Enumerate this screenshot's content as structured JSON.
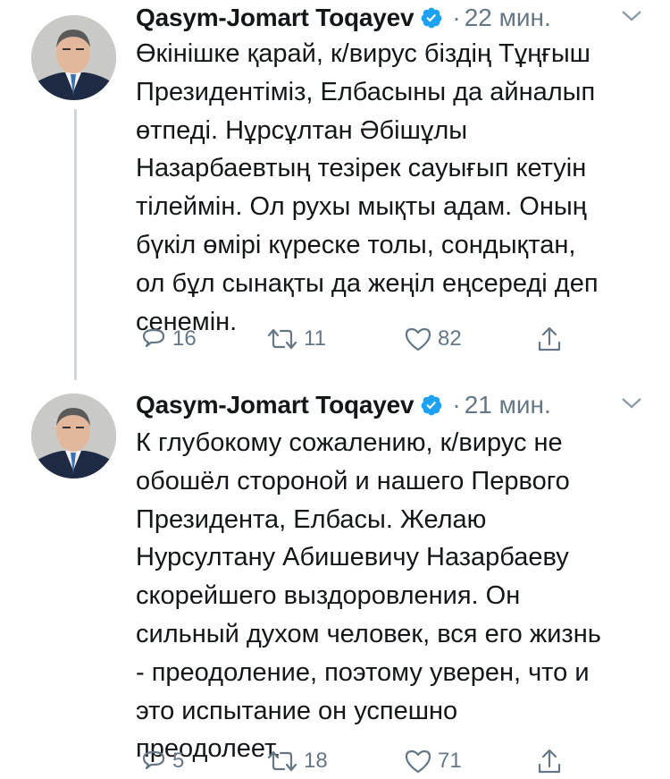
{
  "tweets": [
    {
      "author": "Qasym-Jomart Toqayev",
      "separator": "·",
      "time": "22 мин.",
      "text": "Өкінішке қарай, к/вирус біздің Тұңғыш\nПрезидентіміз, Елбасыны да айналып\nөтпеді. Нұрсұлтан Әбішұлы\nНазарбаевтың тезірек сауығып кетуін\nтілеймін. Ол рухы мықты адам. Оның\nбүкіл өмірі күреске толы, сондықтан,\nол бұл сынақты да жеңіл еңсереді деп\nсенемін.",
      "replies": "16",
      "retweets": "11",
      "likes": "82"
    },
    {
      "author": "Qasym-Jomart Toqayev",
      "separator": "·",
      "time": "21 мин.",
      "text": "К глубокому сожалению, к/вирус не\nобошёл стороной и нашего Первого\nПрезидента, Елбасы. Желаю\nНурсултану Абишевичу Назарбаеву\nскорейшего выздоровления. Он\nсильный духом человек, вся его жизнь\n- преодоление, поэтому уверен, что и\nэто испытание он успешно\nпреодолеет.",
      "replies": "5",
      "retweets": "18",
      "likes": "71"
    }
  ],
  "icons": {
    "reply": "reply-icon",
    "retweet": "retweet-icon",
    "like": "heart-icon",
    "share": "share-icon",
    "verified": "verified-badge-icon",
    "more": "chevron-down-icon"
  },
  "colors": {
    "verified": "#1da1f2",
    "text": "#14171a",
    "muted": "#657786",
    "thread_line": "#ccd6dd"
  }
}
